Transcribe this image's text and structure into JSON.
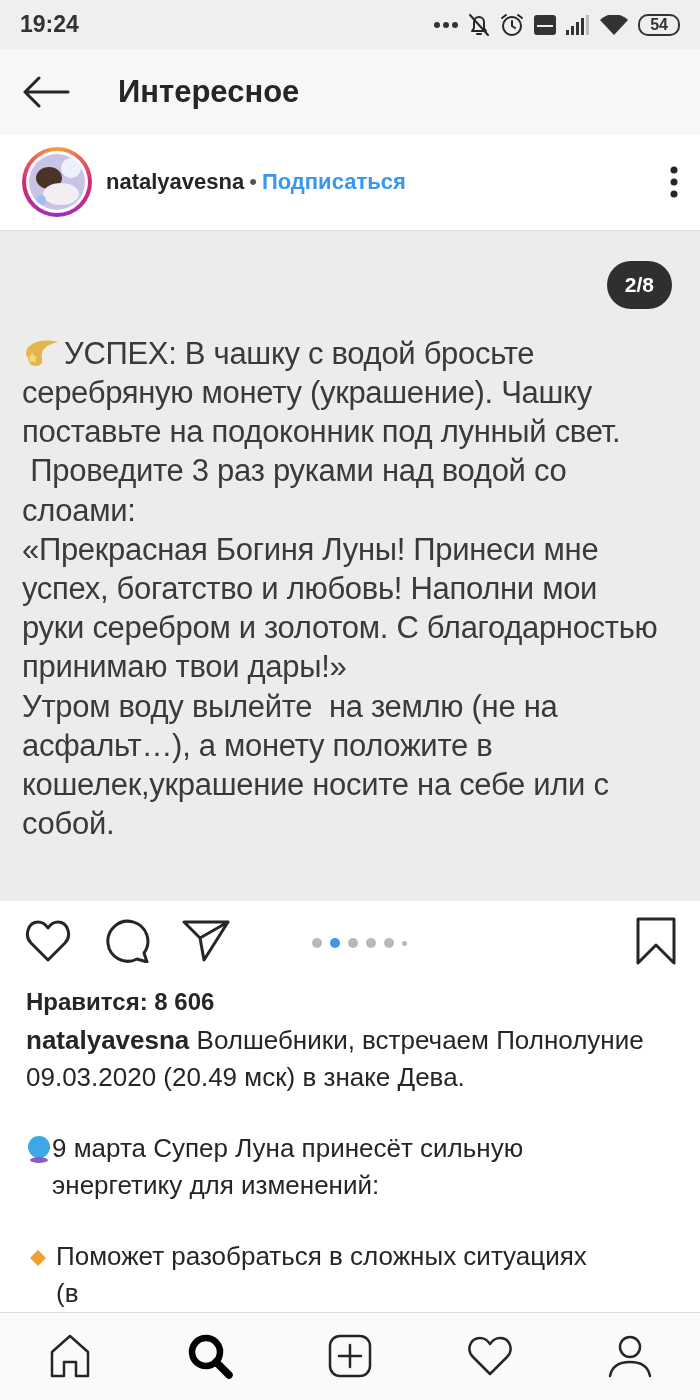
{
  "status_bar": {
    "time": "19:24",
    "battery": "54"
  },
  "header": {
    "title": "Интересное"
  },
  "post": {
    "username": "natalyavesna",
    "separator": "•",
    "follow": "Подписаться",
    "image": {
      "counter": "2/8",
      "lines": [
        "УСПЕХ: В чашку с водой бросьте",
        "серебряную монету (украшение). Чашку",
        "поставьте на подоконник под лунный свет.",
        " Проведите 3 раз руками над водой со",
        "слоами:",
        "«Прекрасная Богиня Луны! Принеси мне",
        "успех, богатство и любовь! Наполни мои",
        "руки серебром и золотом. С благодарностью",
        "принимаю твои дары!»",
        "Утром воду вылейте  на землю (не на",
        "асфальт…), а монету положите в",
        "кошелек,украшение носите на себе или с",
        "собой."
      ]
    },
    "dots": [
      {
        "selected": false
      },
      {
        "selected": true
      },
      {
        "selected": false
      },
      {
        "selected": false
      },
      {
        "selected": false
      },
      {
        "selected": false
      }
    ],
    "likes": "Нравится: 8 606",
    "caption": "**natalyavesna** Волшебники, встречаем Полнолуние 09.03.2020 (20.49 мск) в знаке Дева.",
    "paragraphs": [
      {
        "kind": "crystal",
        "text": "9 марта Супер Луна принесёт сильную энергетику для изменений:"
      },
      {
        "kind": "diamond",
        "text": "Поможет разобраться в  сложных ситуациях (в"
      }
    ]
  },
  "nav": [
    {
      "kind": "home",
      "selected": false
    },
    {
      "kind": "search",
      "selected": true
    },
    {
      "kind": "add",
      "selected": false
    },
    {
      "kind": "heart",
      "selected": false
    },
    {
      "kind": "profile",
      "selected": false
    }
  ]
}
